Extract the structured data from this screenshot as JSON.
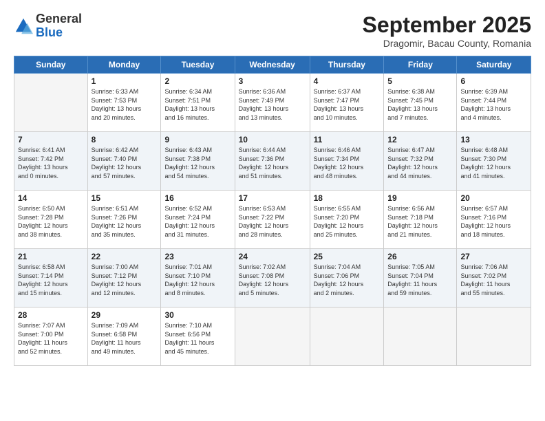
{
  "header": {
    "logo_line1": "General",
    "logo_line2": "Blue",
    "month": "September 2025",
    "location": "Dragomir, Bacau County, Romania"
  },
  "weekdays": [
    "Sunday",
    "Monday",
    "Tuesday",
    "Wednesday",
    "Thursday",
    "Friday",
    "Saturday"
  ],
  "weeks": [
    [
      {
        "day": "",
        "info": ""
      },
      {
        "day": "1",
        "info": "Sunrise: 6:33 AM\nSunset: 7:53 PM\nDaylight: 13 hours\nand 20 minutes."
      },
      {
        "day": "2",
        "info": "Sunrise: 6:34 AM\nSunset: 7:51 PM\nDaylight: 13 hours\nand 16 minutes."
      },
      {
        "day": "3",
        "info": "Sunrise: 6:36 AM\nSunset: 7:49 PM\nDaylight: 13 hours\nand 13 minutes."
      },
      {
        "day": "4",
        "info": "Sunrise: 6:37 AM\nSunset: 7:47 PM\nDaylight: 13 hours\nand 10 minutes."
      },
      {
        "day": "5",
        "info": "Sunrise: 6:38 AM\nSunset: 7:45 PM\nDaylight: 13 hours\nand 7 minutes."
      },
      {
        "day": "6",
        "info": "Sunrise: 6:39 AM\nSunset: 7:44 PM\nDaylight: 13 hours\nand 4 minutes."
      }
    ],
    [
      {
        "day": "7",
        "info": "Sunrise: 6:41 AM\nSunset: 7:42 PM\nDaylight: 13 hours\nand 0 minutes."
      },
      {
        "day": "8",
        "info": "Sunrise: 6:42 AM\nSunset: 7:40 PM\nDaylight: 12 hours\nand 57 minutes."
      },
      {
        "day": "9",
        "info": "Sunrise: 6:43 AM\nSunset: 7:38 PM\nDaylight: 12 hours\nand 54 minutes."
      },
      {
        "day": "10",
        "info": "Sunrise: 6:44 AM\nSunset: 7:36 PM\nDaylight: 12 hours\nand 51 minutes."
      },
      {
        "day": "11",
        "info": "Sunrise: 6:46 AM\nSunset: 7:34 PM\nDaylight: 12 hours\nand 48 minutes."
      },
      {
        "day": "12",
        "info": "Sunrise: 6:47 AM\nSunset: 7:32 PM\nDaylight: 12 hours\nand 44 minutes."
      },
      {
        "day": "13",
        "info": "Sunrise: 6:48 AM\nSunset: 7:30 PM\nDaylight: 12 hours\nand 41 minutes."
      }
    ],
    [
      {
        "day": "14",
        "info": "Sunrise: 6:50 AM\nSunset: 7:28 PM\nDaylight: 12 hours\nand 38 minutes."
      },
      {
        "day": "15",
        "info": "Sunrise: 6:51 AM\nSunset: 7:26 PM\nDaylight: 12 hours\nand 35 minutes."
      },
      {
        "day": "16",
        "info": "Sunrise: 6:52 AM\nSunset: 7:24 PM\nDaylight: 12 hours\nand 31 minutes."
      },
      {
        "day": "17",
        "info": "Sunrise: 6:53 AM\nSunset: 7:22 PM\nDaylight: 12 hours\nand 28 minutes."
      },
      {
        "day": "18",
        "info": "Sunrise: 6:55 AM\nSunset: 7:20 PM\nDaylight: 12 hours\nand 25 minutes."
      },
      {
        "day": "19",
        "info": "Sunrise: 6:56 AM\nSunset: 7:18 PM\nDaylight: 12 hours\nand 21 minutes."
      },
      {
        "day": "20",
        "info": "Sunrise: 6:57 AM\nSunset: 7:16 PM\nDaylight: 12 hours\nand 18 minutes."
      }
    ],
    [
      {
        "day": "21",
        "info": "Sunrise: 6:58 AM\nSunset: 7:14 PM\nDaylight: 12 hours\nand 15 minutes."
      },
      {
        "day": "22",
        "info": "Sunrise: 7:00 AM\nSunset: 7:12 PM\nDaylight: 12 hours\nand 12 minutes."
      },
      {
        "day": "23",
        "info": "Sunrise: 7:01 AM\nSunset: 7:10 PM\nDaylight: 12 hours\nand 8 minutes."
      },
      {
        "day": "24",
        "info": "Sunrise: 7:02 AM\nSunset: 7:08 PM\nDaylight: 12 hours\nand 5 minutes."
      },
      {
        "day": "25",
        "info": "Sunrise: 7:04 AM\nSunset: 7:06 PM\nDaylight: 12 hours\nand 2 minutes."
      },
      {
        "day": "26",
        "info": "Sunrise: 7:05 AM\nSunset: 7:04 PM\nDaylight: 11 hours\nand 59 minutes."
      },
      {
        "day": "27",
        "info": "Sunrise: 7:06 AM\nSunset: 7:02 PM\nDaylight: 11 hours\nand 55 minutes."
      }
    ],
    [
      {
        "day": "28",
        "info": "Sunrise: 7:07 AM\nSunset: 7:00 PM\nDaylight: 11 hours\nand 52 minutes."
      },
      {
        "day": "29",
        "info": "Sunrise: 7:09 AM\nSunset: 6:58 PM\nDaylight: 11 hours\nand 49 minutes."
      },
      {
        "day": "30",
        "info": "Sunrise: 7:10 AM\nSunset: 6:56 PM\nDaylight: 11 hours\nand 45 minutes."
      },
      {
        "day": "",
        "info": ""
      },
      {
        "day": "",
        "info": ""
      },
      {
        "day": "",
        "info": ""
      },
      {
        "day": "",
        "info": ""
      }
    ]
  ]
}
